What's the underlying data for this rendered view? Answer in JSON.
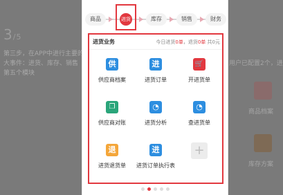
{
  "background_left": {
    "heading": "3",
    "heading_suffix": "/5",
    "lines": [
      "第三步，在APP中进行主要的",
      "大事件：进货、库存、销售",
      "第五个模块"
    ]
  },
  "background_right": {
    "top_text": "用户已配置2个，进货",
    "item1": "商品档案",
    "item2": "库存方案"
  },
  "steps": {
    "items": [
      {
        "label": "商品"
      },
      {
        "label": "进货"
      },
      {
        "label": "库存"
      },
      {
        "label": "销售"
      },
      {
        "label": "财务"
      }
    ],
    "active_index": 1
  },
  "card": {
    "title": "进货业务",
    "stats_prefix": "今日进货",
    "stats_value1": "0单",
    "stats_sep": "，退货",
    "stats_value2": "0单",
    "stats_total": "共0元"
  },
  "functions": [
    {
      "label": "供应商档案",
      "icon_text": "供",
      "icon": "supplier-icon",
      "color": "#2d8ee0"
    },
    {
      "label": "进货订单",
      "icon_text": "进",
      "icon": "purchase-order-icon",
      "color": "#2d8ee0"
    },
    {
      "label": "开进货单",
      "icon_text": "🛒",
      "icon": "cart-icon",
      "color": "#e2383f"
    },
    {
      "label": "供应商对账",
      "icon_text": "❐",
      "icon": "reconcile-icon",
      "color": "#2aa57a"
    },
    {
      "label": "进货分析",
      "icon_text": "◔",
      "icon": "pie-chart-icon",
      "color": "#2d8ee0"
    },
    {
      "label": "查进货单",
      "icon_text": "◔",
      "icon": "pie-chart-icon",
      "color": "#2d8ee0"
    },
    {
      "label": "进货退货单",
      "icon_text": "退",
      "icon": "return-icon",
      "color": "#f4a63a"
    },
    {
      "label": "进货订单执行表",
      "icon_text": "进",
      "icon": "order-execution-icon",
      "color": "#2d8ee0"
    },
    {
      "label": "",
      "icon_text": "+",
      "icon": "plus-icon",
      "color": "#ececec"
    }
  ],
  "pagination": {
    "pages": 5,
    "current": 1
  }
}
